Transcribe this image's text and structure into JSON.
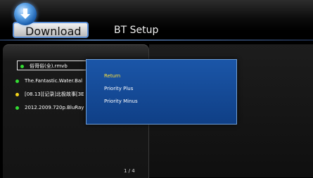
{
  "tabs": {
    "active": "Download",
    "other": "BT Setup"
  },
  "downloads": [
    {
      "name": "俗哥俗(全).rmvb",
      "status_color": "#33dd33",
      "selected": true
    },
    {
      "name": "The.Fantastic.Water.Bal",
      "status_color": "#33dd33",
      "selected": false
    },
    {
      "name": "[08.13][记录]北极故事[3E",
      "status_color": "#f2d21a",
      "selected": false
    },
    {
      "name": "2012.2009.720p.BluRay",
      "status_color": "#33dd33",
      "selected": false
    }
  ],
  "pagination": "1 / 4",
  "popup_menu": {
    "items": [
      {
        "label": "Return",
        "highlighted": true,
        "color": "#ffe23a"
      },
      {
        "label": "Priority Plus",
        "highlighted": false,
        "color": "#ffffff"
      },
      {
        "label": "Priority Minus",
        "highlighted": false,
        "color": "#ffffff"
      }
    ]
  },
  "colors": {
    "accent": "#5b8fd6",
    "menu_bg": "#1b56a8",
    "highlight_text": "#ffe23a"
  }
}
